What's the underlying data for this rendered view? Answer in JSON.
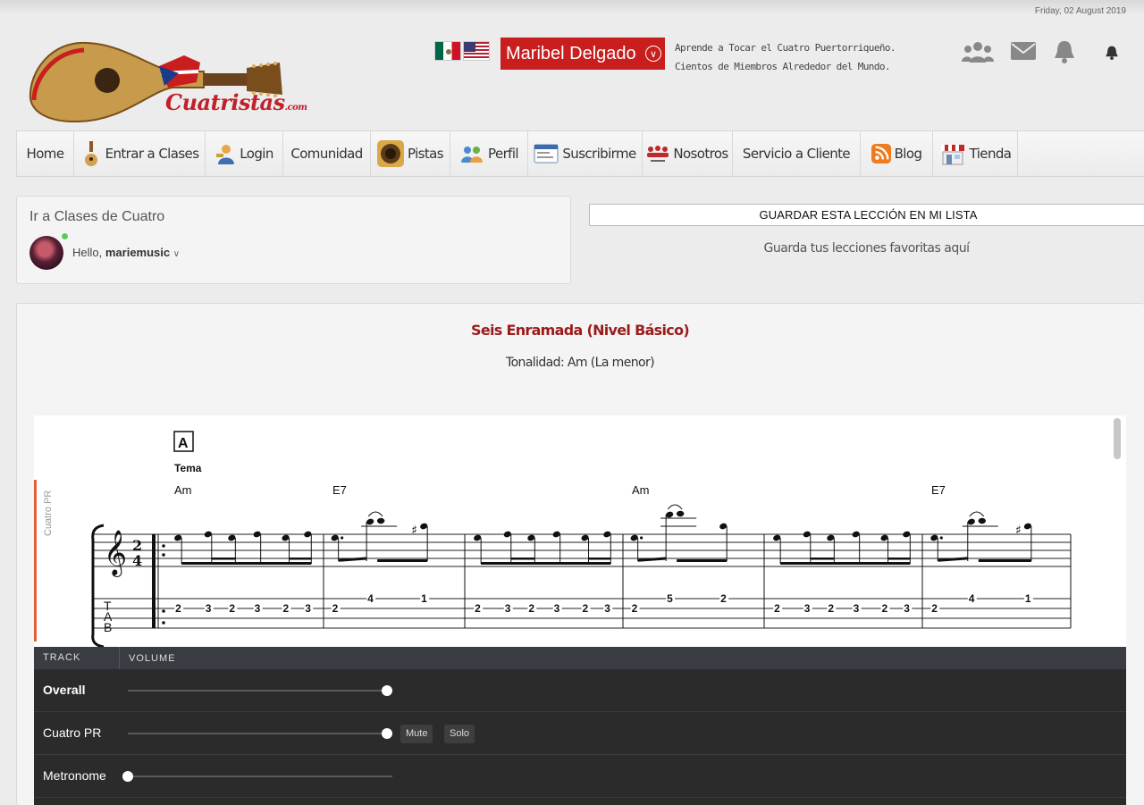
{
  "header": {
    "date": "Friday, 02 August 2019",
    "user_display_name": "Maribel Delgado",
    "tagline": "Aprende a Tocar el Cuatro Puertorriqueño. Cientos de Miembros Alrededor del Mundo.",
    "logo_text": "Cuatristas",
    "logo_suffix": ".com",
    "icons": [
      "users-icon",
      "envelope-icon",
      "bell-icon",
      "bell-small-icon"
    ],
    "flags": [
      "mexico-flag",
      "usa-flag"
    ]
  },
  "nav": {
    "items": [
      {
        "label": "Home",
        "icon": ""
      },
      {
        "label": "Entrar a Clases",
        "icon": "cuatro-icon"
      },
      {
        "label": "Login",
        "icon": "user-key-icon"
      },
      {
        "label": "Comunidad",
        "icon": ""
      },
      {
        "label": "Pistas",
        "icon": "guitar-body-icon"
      },
      {
        "label": "Perfil",
        "icon": "people-icon"
      },
      {
        "label": "Suscribirme",
        "icon": "form-icon"
      },
      {
        "label": "Nosotros",
        "icon": "about-us-icon"
      },
      {
        "label": "Servicio a Cliente",
        "icon": ""
      },
      {
        "label": "Blog",
        "icon": "rss-icon"
      },
      {
        "label": "Tienda",
        "icon": "store-icon"
      }
    ]
  },
  "classes_card": {
    "title": "Ir a Clases de Cuatro",
    "hello_prefix": "Hello, ",
    "username": "mariemusic"
  },
  "lesson": {
    "save_button": "GUARDAR ESTA LECCIÓN EN MI LISTA",
    "save_subtitle": "Guarda tus lecciones favoritas aquí",
    "title": "Seis Enramada (Nivel Básico)",
    "key": "Tonalidad: Am (La menor)"
  },
  "score": {
    "track_name": "Cuatro PR",
    "section_marker": "A",
    "section_name": "Tema",
    "time_signature": [
      "2",
      "4"
    ],
    "tab_letters": [
      "T",
      "A",
      "B"
    ],
    "measures": [
      {
        "chord": "Am",
        "tab": [
          "2",
          "3",
          "2",
          "3",
          "2",
          "3"
        ]
      },
      {
        "chord": "E7",
        "tab": [
          "2",
          "4",
          "1"
        ]
      },
      {
        "chord": "",
        "tab": [
          "2",
          "3",
          "2",
          "3",
          "2",
          "3"
        ]
      },
      {
        "chord": "Am",
        "tab": [
          "2",
          "5",
          "2"
        ]
      },
      {
        "chord": "",
        "tab": [
          "2",
          "3",
          "2",
          "3",
          "2",
          "3"
        ]
      },
      {
        "chord": "E7",
        "tab": [
          "2",
          "4",
          "1"
        ]
      }
    ]
  },
  "mixer": {
    "col_track": "TRACK",
    "col_volume": "VOLUME",
    "rows": [
      {
        "name": "Overall",
        "volume": 1.0,
        "bold": true
      },
      {
        "name": "Cuatro PR",
        "volume": 1.0,
        "mute": "Mute",
        "solo": "Solo"
      },
      {
        "name": "Metronome",
        "volume": 0.0
      }
    ]
  }
}
